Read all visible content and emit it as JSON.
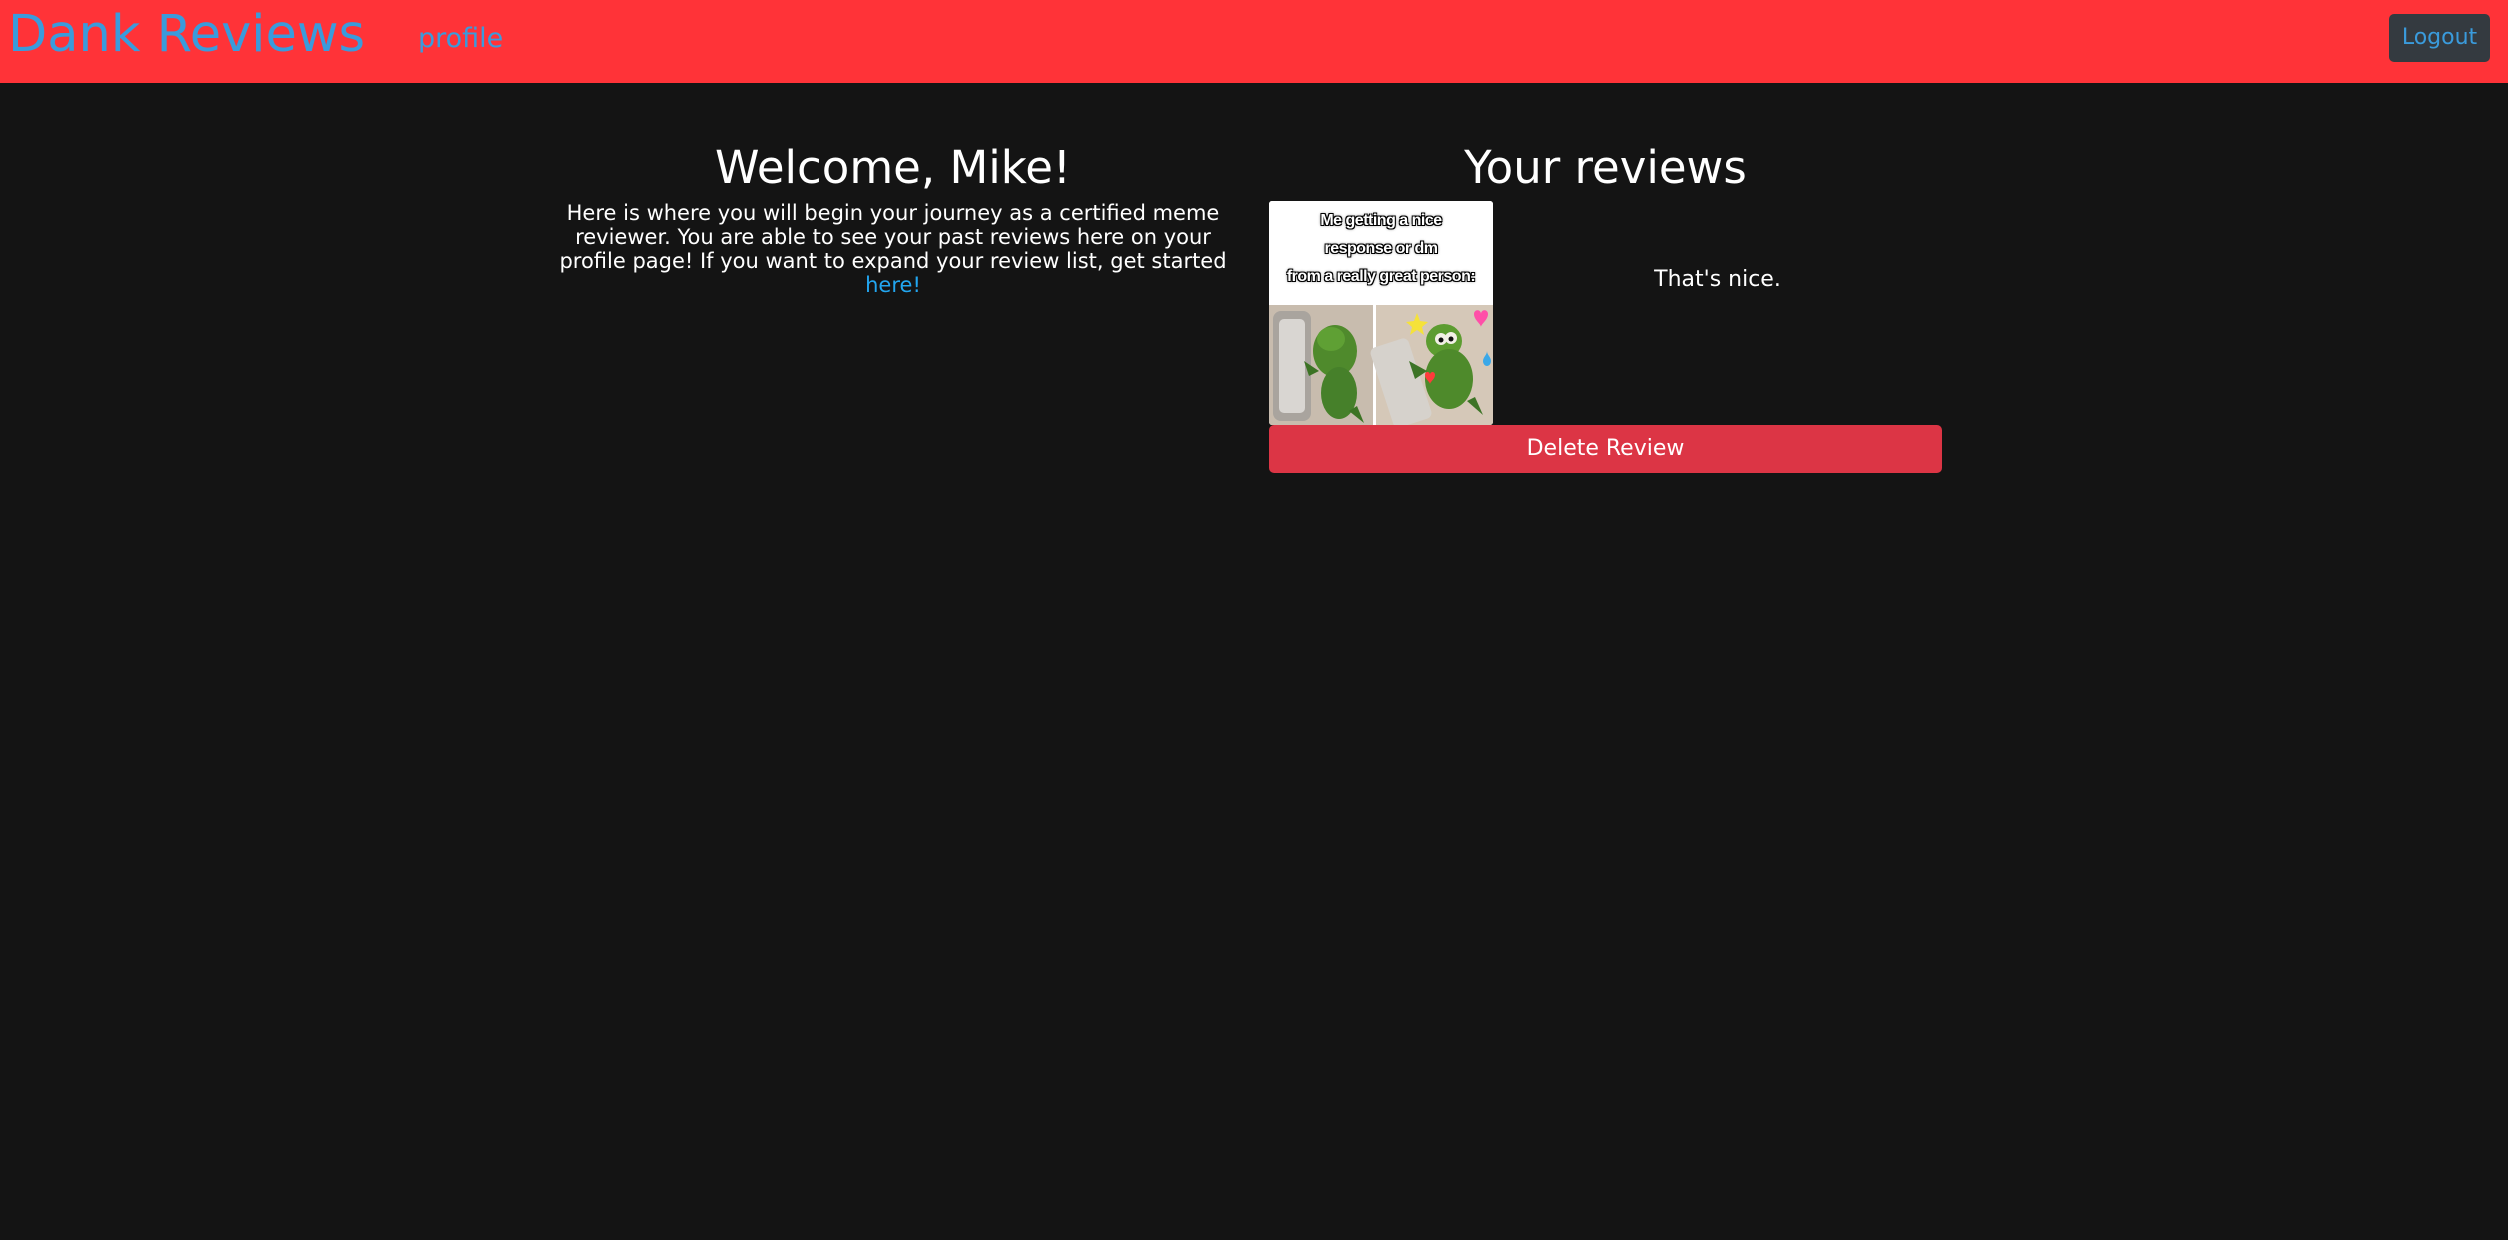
{
  "nav": {
    "brand": "Dank Reviews",
    "profile_link": "profile",
    "logout_label": "Logout"
  },
  "welcome": {
    "title": "Welcome, Mike!",
    "intro": "Here is where you will begin your journey as a certified meme reviewer. You are able to see your past reviews here on your profile page! If you want to expand your review list, get started",
    "link_text": "here!"
  },
  "reviews": {
    "title": "Your reviews",
    "items": [
      {
        "meme_caption_lines": [
          "Me getting a nice",
          "response or dm",
          "from a really great person:"
        ],
        "text": "That's nice.",
        "delete_label": "Delete Review"
      }
    ]
  },
  "colors": {
    "navbar": "#ff3338",
    "link": "#3a9bdc",
    "background": "#141414",
    "danger": "#dc3545"
  }
}
